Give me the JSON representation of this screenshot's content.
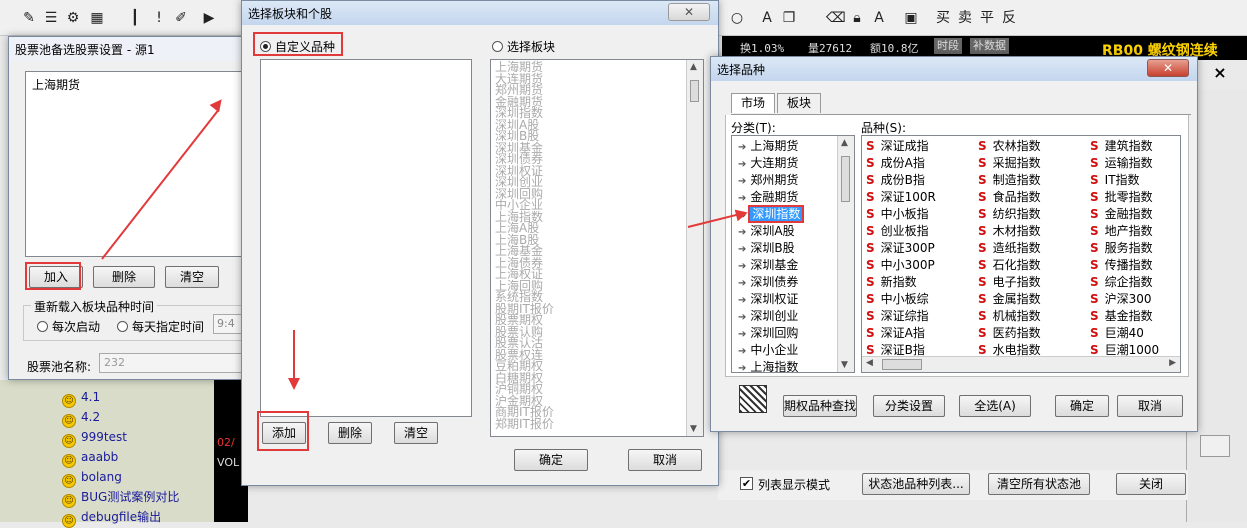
{
  "background": {
    "toolbar_icons": [
      "pin-icon",
      "bars-icon",
      "network-icon",
      "grid-icon",
      "candles-icon",
      "download-icon",
      "warning-icon",
      "edit-icon",
      "play-icon",
      "circle-icon",
      "text-a-icon",
      "copy-icon",
      "trash-icon",
      "lock-icon"
    ],
    "toolbar_text": [
      "买",
      "卖",
      "平",
      "反"
    ],
    "status": {
      "change": "换1.03%",
      "volume": "量27612",
      "amount": "额10.8亿",
      "btn_timeshare": "时段",
      "btn_fill": "补数据"
    },
    "corner_title": "RB00 螺纹钢连续",
    "corner_close": "×",
    "tree_items": [
      "4.1",
      "4.2",
      "999test",
      "aaabb",
      "bolang",
      "BUG测试案例对比",
      "debugfile输出"
    ],
    "chart_labels": [
      "02/",
      "VOL"
    ],
    "bottom_bar": {
      "checkbox_label": "列表显示模式",
      "btn_status_list": "状态池品种列表...",
      "btn_clear_all": "清空所有状态池",
      "btn_close": "关闭"
    }
  },
  "pool_dialog": {
    "title": "股票池备选股票设置 - 源1",
    "list_items": [
      "上海期货"
    ],
    "btn_add": "加入",
    "btn_delete": "删除",
    "btn_clear": "清空",
    "reload_group": "重新载入板块品种时间",
    "radio_each_start": "每次启动",
    "radio_daily": "每天指定时间",
    "time_value": "9:4",
    "pool_name_label": "股票池名称:",
    "pool_name_value": "232"
  },
  "board_dialog": {
    "title": "选择板块和个股",
    "close": "✕",
    "radio_custom": "自定义品种",
    "radio_board": "选择板块",
    "board_list": [
      "上海期货",
      "大连期货",
      "郑州期货",
      "金融期货",
      "深圳指数",
      "深圳A股",
      "深圳B股",
      "深圳基金",
      "深圳债券",
      "深圳权证",
      "深圳创业",
      "深圳回购",
      "中小企业",
      "上海指数",
      "上海A股",
      "上海B股",
      "上海基金",
      "上海债券",
      "上海权证",
      "上海回购",
      "系统指数",
      "股期IT报价",
      "股票期权",
      "股票认购",
      "股票认沽",
      "股票权连",
      "豆粕期权",
      "白糖期权",
      "沪铜期权",
      "沪金期权",
      "商期IT报价",
      "郑期IT报价"
    ],
    "btn_add": "添加",
    "btn_delete": "删除",
    "btn_clear": "清空",
    "btn_ok": "确定",
    "btn_cancel": "取消"
  },
  "product_dialog": {
    "title": "选择品种",
    "close": "✕",
    "tab_market": "市场",
    "tab_board": "板块",
    "category_label": "分类(T):",
    "product_label": "品种(S):",
    "categories": [
      "上海期货",
      "大连期货",
      "郑州期货",
      "金融期货",
      "深圳指数",
      "深圳A股",
      "深圳B股",
      "深圳基金",
      "深圳债券",
      "深圳权证",
      "深圳创业",
      "深圳回购",
      "中小企业",
      "上海指数"
    ],
    "selected_category": "深圳指数",
    "products": [
      [
        "深证成指",
        "农林指数",
        "建筑指数"
      ],
      [
        "成份A指",
        "采掘指数",
        "运输指数"
      ],
      [
        "成份B指",
        "制造指数",
        "IT指数"
      ],
      [
        "深证100R",
        "食品指数",
        "批零指数"
      ],
      [
        "中小板指",
        "纺织指数",
        "金融指数"
      ],
      [
        "创业板指",
        "木材指数",
        "地产指数"
      ],
      [
        "深证300P",
        "造纸指数",
        "服务指数"
      ],
      [
        "中小300P",
        "石化指数",
        "传播指数"
      ],
      [
        "新指数",
        "电子指数",
        "综企指数"
      ],
      [
        "中小板综",
        "金属指数",
        "沪深300"
      ],
      [
        "深证综指",
        "机械指数",
        "基金指数"
      ],
      [
        "深证A指",
        "医药指数",
        "巨潮40"
      ],
      [
        "深证B指",
        "水电指数",
        "巨潮1000"
      ]
    ],
    "s_mark": "S",
    "btn_option_search": "期权品种查找",
    "btn_category_settings": "分类设置",
    "btn_select_all": "全选(A)",
    "btn_ok": "确定",
    "btn_cancel": "取消"
  },
  "colors": {
    "highlight": "#3399ff",
    "annotation_red": "#e23a3a",
    "s_red": "#d01010"
  }
}
